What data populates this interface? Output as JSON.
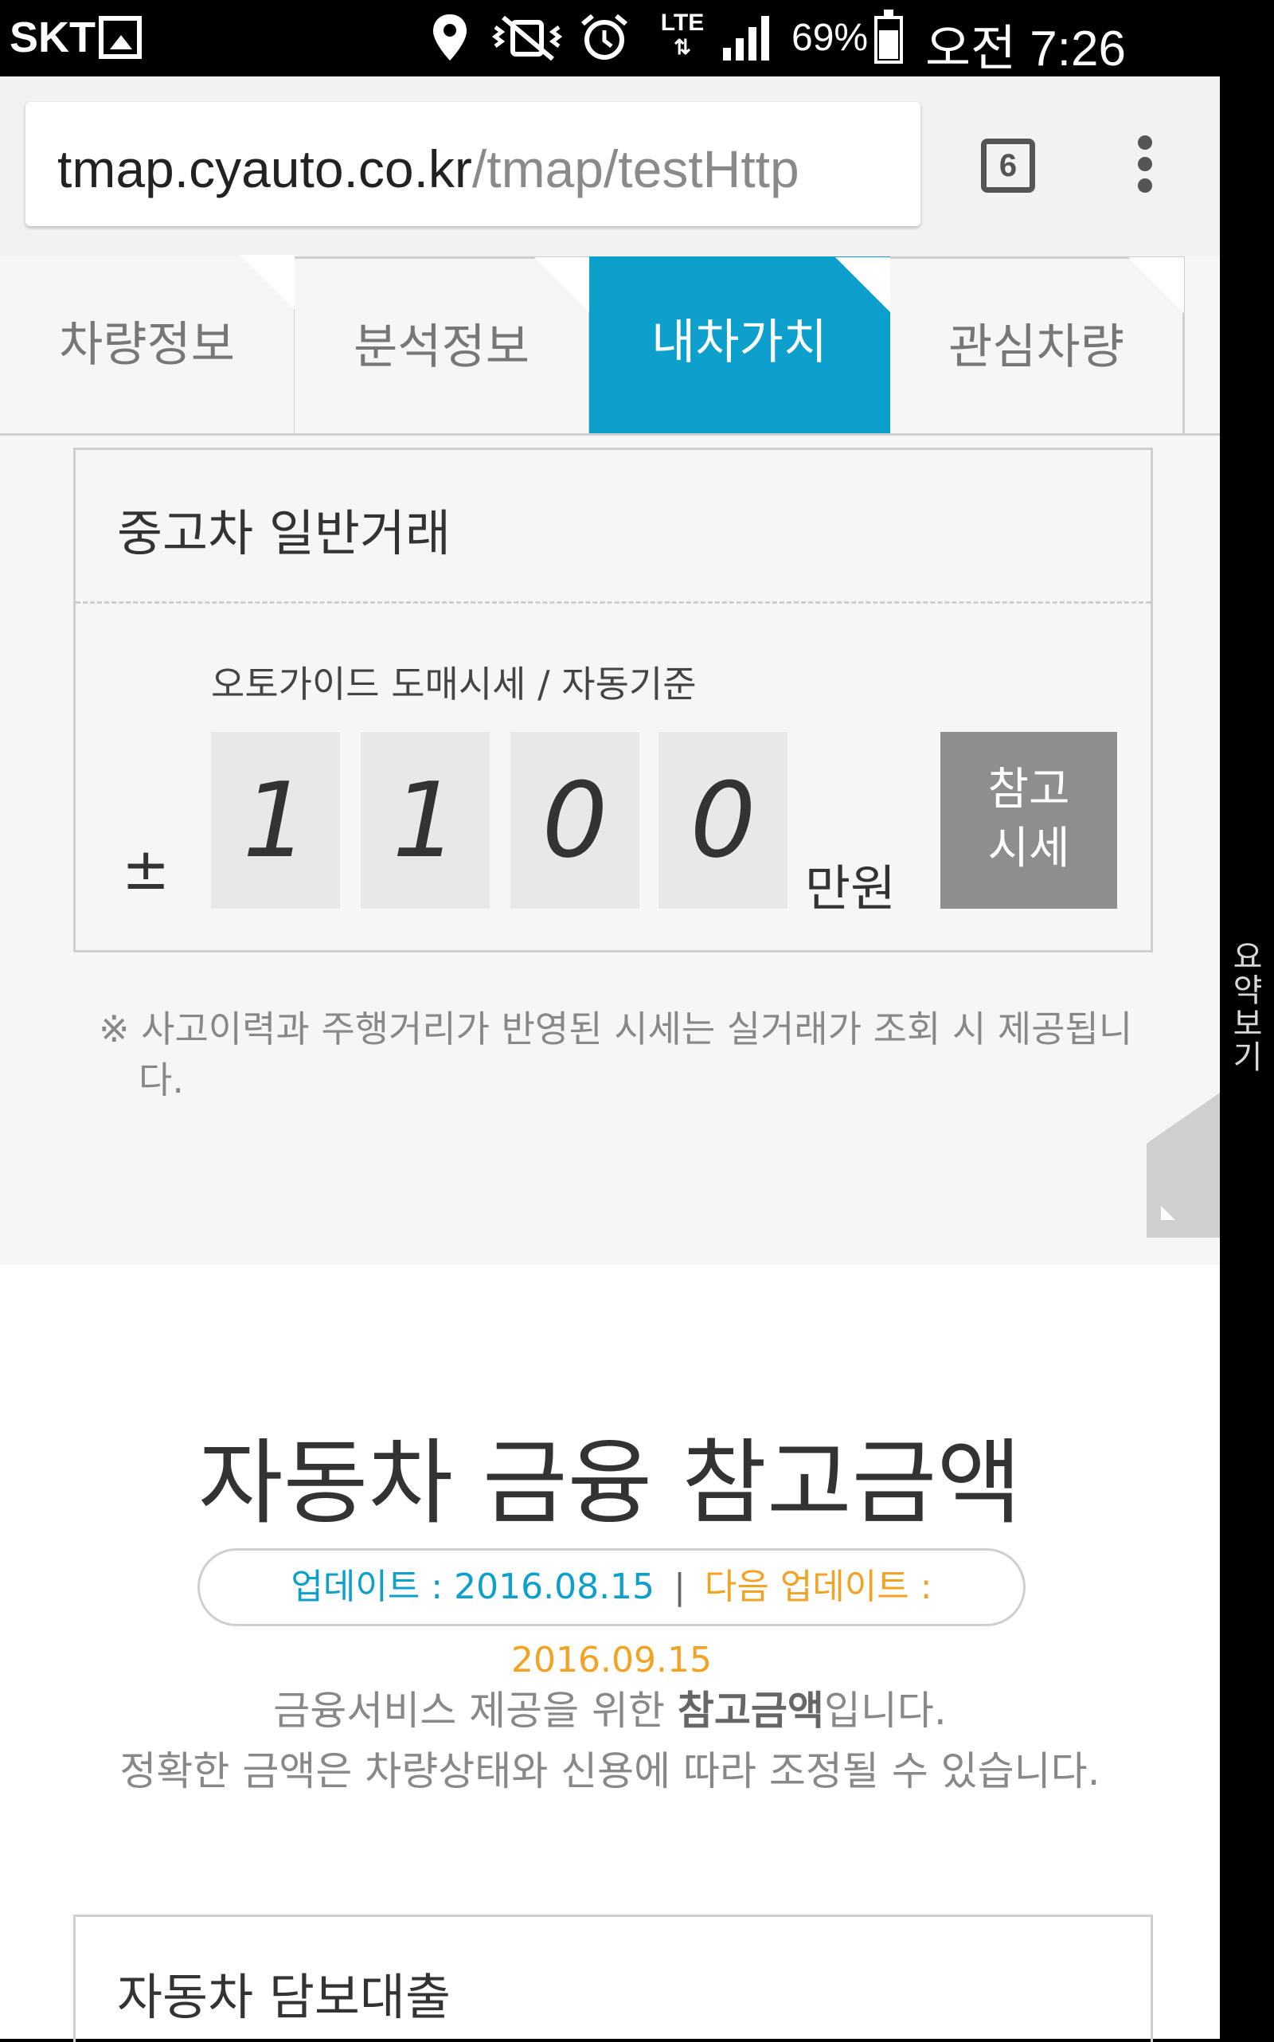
{
  "status_bar": {
    "carrier": "SKT",
    "network": "LTE",
    "battery": "69%",
    "time": "오전 7:26",
    "icons": [
      "image-icon",
      "location-icon",
      "mute-vibrate-icon",
      "alarm-icon",
      "lte-icon",
      "signal-icon",
      "battery-icon"
    ]
  },
  "browser": {
    "url_host": "tmap.cyauto.co.kr",
    "url_path": "/tmap/testHttp",
    "tab_count": "6"
  },
  "tabs": [
    {
      "label": "차량정보",
      "active": false
    },
    {
      "label": "분석정보",
      "active": false
    },
    {
      "label": "내차가치",
      "active": true
    },
    {
      "label": "관심차량",
      "active": false
    }
  ],
  "trade_card": {
    "title": "중고차 일반거래",
    "subtitle": "오토가이드 도매시세 / 자동기준",
    "plus_minus": "±",
    "digits": [
      "1",
      "1",
      "0",
      "0"
    ],
    "unit": "만원",
    "ref_button": [
      "참고",
      "시세"
    ]
  },
  "note": "※ 사고이력과 주행거리가 반영된 시세는 실거래가 조회 시 제공됩니다.",
  "side_text": "요약보기",
  "finance": {
    "title": "자동차 금융 참고금액",
    "update_label": "업데이트 : 2016.08.15",
    "separator": "|",
    "next_update_label": "다음 업데이트 : 2016.09.15",
    "desc_prefix": "금융서비스 제공을 위한 ",
    "desc_bold": "참고금액",
    "desc_suffix": "입니다.",
    "desc_line2": "정확한 금액은 차량상태와 신용에 따라 조정될 수 있습니다.",
    "loan_title": "자동차 담보대출"
  },
  "colors": {
    "accent": "#0ea0cc",
    "orange": "#f3a324",
    "button_gray": "#8e8e8e"
  }
}
